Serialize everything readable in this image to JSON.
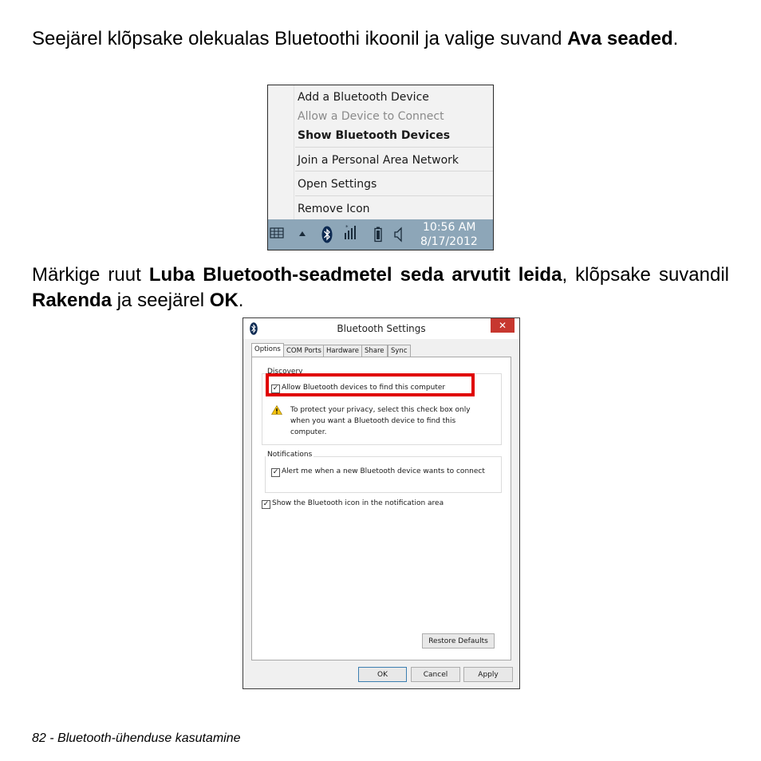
{
  "para1": {
    "text_a": "Seejärel klõpsake olekualas Bluetoothi ikoonil ja valige suvand ",
    "bold_a": "Ava seaded",
    "text_b": "."
  },
  "context_menu": {
    "items": [
      {
        "label": "Add a Bluetooth Device",
        "state": "normal"
      },
      {
        "label": "Allow a Device to Connect",
        "state": "disabled"
      },
      {
        "label": "Show Bluetooth Devices",
        "state": "bold"
      },
      {
        "label": "Join a Personal Area Network",
        "state": "normal"
      },
      {
        "label": "Open Settings",
        "state": "normal"
      },
      {
        "label": "Remove Icon",
        "state": "normal"
      }
    ],
    "taskbar": {
      "time": "10:56 AM",
      "date": "8/17/2012",
      "icons": [
        "keyboard-icon",
        "chevron-up-icon",
        "bluetooth-icon",
        "network-signal-icon",
        "battery-icon",
        "speaker-icon"
      ]
    }
  },
  "para2": {
    "text_a": "Märkige ruut ",
    "bold_a": "Luba Bluetooth-seadmetel seda arvutit leida",
    "text_b": ", klõpsake suvandil ",
    "bold_b": "Rakenda",
    "text_c": " ja seejärel ",
    "bold_c": "OK",
    "text_d": "."
  },
  "dialog": {
    "title": "Bluetooth Settings",
    "close_glyph": "✕",
    "tabs": [
      "Options",
      "COM Ports",
      "Hardware",
      "Share",
      "Sync"
    ],
    "active_tab": "Options",
    "discovery": {
      "label": "Discovery",
      "checkbox_label": "Allow Bluetooth devices to find this computer",
      "checked": true,
      "note": "To protect your privacy, select this check box only when you want a Bluetooth device to find this computer."
    },
    "notifications": {
      "label": "Notifications",
      "checkbox_label": "Alert me when a new Bluetooth device wants to connect",
      "checked": true
    },
    "show_icon": {
      "checkbox_label": "Show the Bluetooth icon in the notification area",
      "checked": true
    },
    "restore_label": "Restore Defaults",
    "ok_label": "OK",
    "cancel_label": "Cancel",
    "apply_label": "Apply",
    "check_glyph": "✓",
    "highlight_color": "#e00000"
  },
  "footer": {
    "text": "82 - Bluetooth-ühenduse kasutamine"
  }
}
